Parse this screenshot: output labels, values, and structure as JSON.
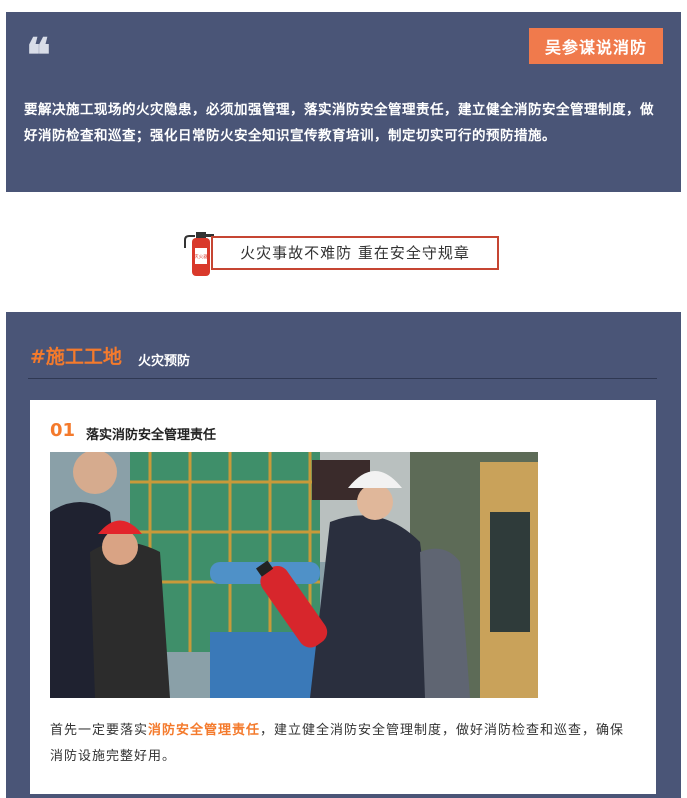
{
  "top": {
    "quote_icon": "quote-mark-icon",
    "badge": "吴参谋说消防",
    "text": "要解决施工现场的火灾隐患，必须加强管理，落实消防安全管理责任，建立健全消防安全管理制度，做好消防检查和巡查；强化日常防火安全知识宣传教育培训，制定切实可行的预防措施。"
  },
  "slogan": {
    "text": "火灾事故不难防  重在安全守规章",
    "icon": "fire-extinguisher-icon",
    "icon_label": "灭火器"
  },
  "section": {
    "title": "#施工工地",
    "subtitle": "火灾预防"
  },
  "card": {
    "number": "01",
    "title": "落实消防安全管理责任",
    "photo": "construction-site-fire-inspection-photo",
    "text_before": "首先一定要落实",
    "text_highlight": "消防安全管理责任",
    "text_after": "，建立健全消防安全管理制度，做好消防检查和巡查，确保消防设施完整好用。"
  },
  "colors": {
    "panel": "#4a5577",
    "accent_orange": "#f47a2c",
    "badge": "#f07a4c",
    "slogan_border": "#c64532"
  }
}
